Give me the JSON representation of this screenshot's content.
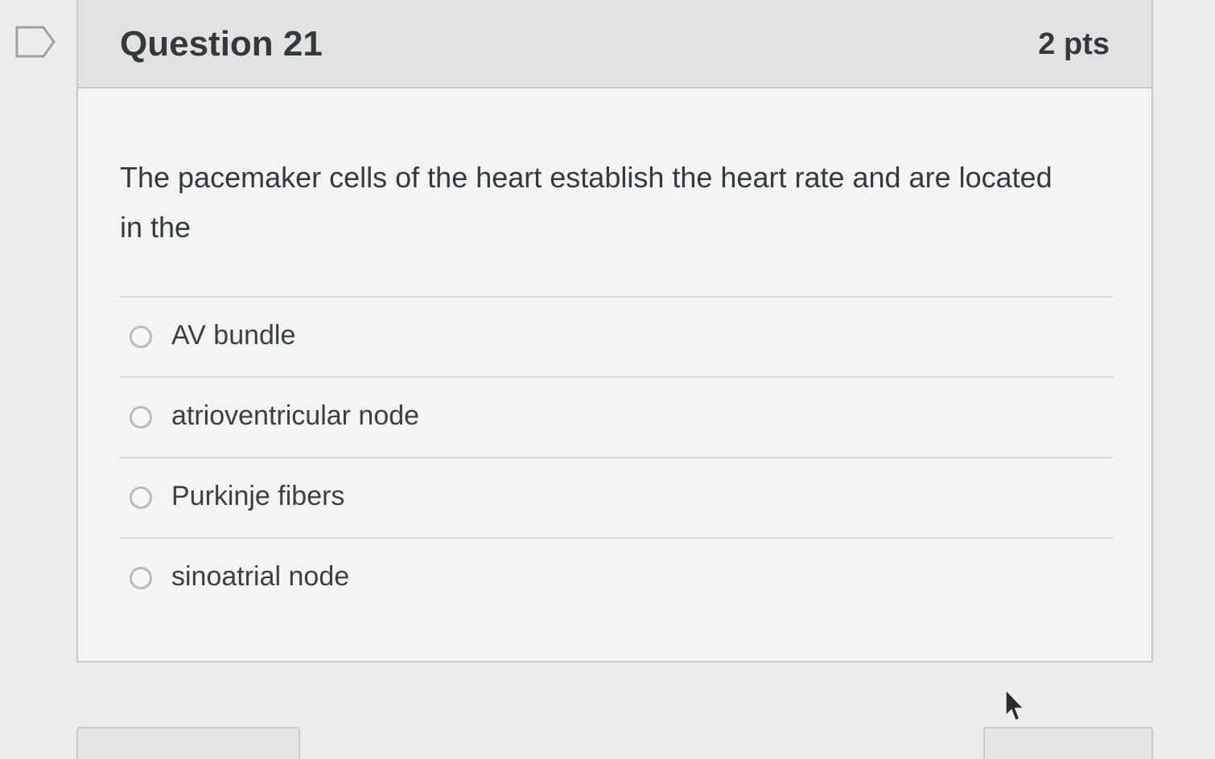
{
  "question": {
    "title": "Question 21",
    "points": "2 pts",
    "text": "The pacemaker cells of the heart establish the heart rate and are located in the"
  },
  "answers": [
    {
      "label": "AV bundle",
      "selected": false
    },
    {
      "label": "atrioventricular node",
      "selected": false
    },
    {
      "label": "Purkinje fibers",
      "selected": false
    },
    {
      "label": "sinoatrial node",
      "selected": false
    }
  ],
  "icons": {
    "flag": "flag-icon",
    "cursor": "mouse-pointer-icon"
  }
}
